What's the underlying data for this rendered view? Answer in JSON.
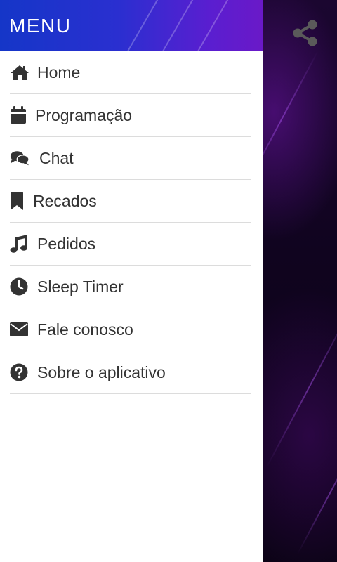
{
  "drawer": {
    "title": "MENU",
    "items": [
      {
        "label": "Home",
        "icon": "home-icon"
      },
      {
        "label": "Programação",
        "icon": "calendar-icon"
      },
      {
        "label": "Chat",
        "icon": "chat-icon"
      },
      {
        "label": "Recados",
        "icon": "bookmark-icon"
      },
      {
        "label": "Pedidos",
        "icon": "music-note-icon"
      },
      {
        "label": "Sleep Timer",
        "icon": "clock-icon"
      },
      {
        "label": "Fale conosco",
        "icon": "envelope-icon"
      },
      {
        "label": "Sobre o aplicativo",
        "icon": "question-circle-icon"
      }
    ]
  },
  "share": {
    "icon": "share-icon"
  },
  "colors": {
    "header_start": "#1536c8",
    "header_end": "#6a19c8",
    "icon": "#333333",
    "text": "#333333",
    "divider": "#dcdcdc",
    "share_icon": "#5a5a5a"
  }
}
